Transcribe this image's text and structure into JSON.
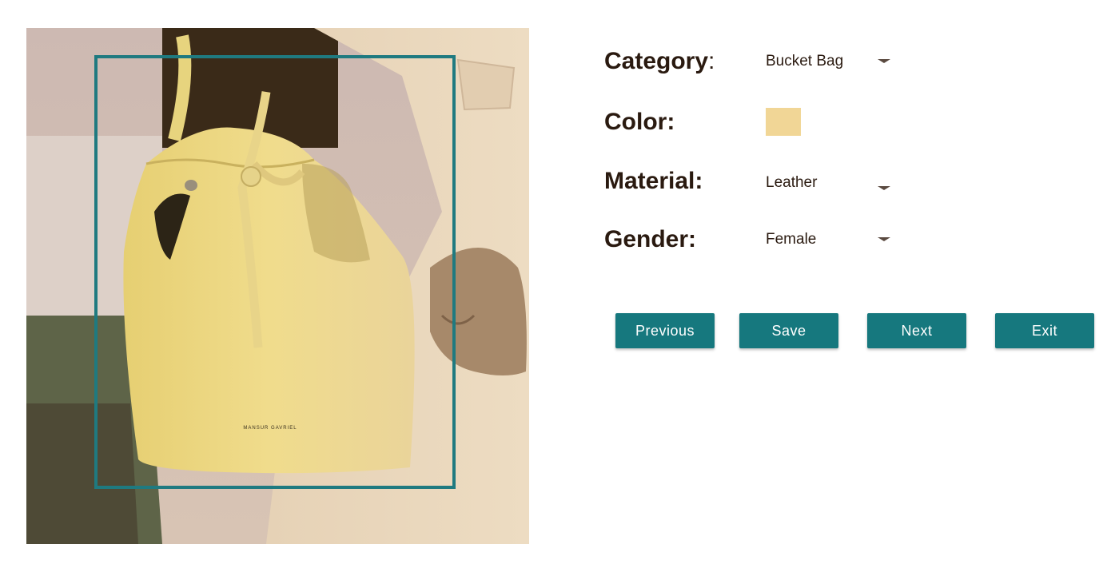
{
  "attributes": {
    "category": {
      "label": "Category",
      "colon": ":",
      "value": "Bucket Bag"
    },
    "color": {
      "label": "Color:",
      "swatch_hex": "#f1d696"
    },
    "material": {
      "label": "Material:",
      "value": "Leather"
    },
    "gender": {
      "label": "Gender:",
      "value": "Female"
    }
  },
  "buttons": {
    "previous": "Previous",
    "save": "Save",
    "next": "Next",
    "exit": "Exit"
  },
  "photo": {
    "brand_text": "MANSUR GAVRIEL",
    "bbox_color": "#1f7a80"
  },
  "colors": {
    "accent": "#16787e",
    "label_text": "#2a1a10"
  }
}
